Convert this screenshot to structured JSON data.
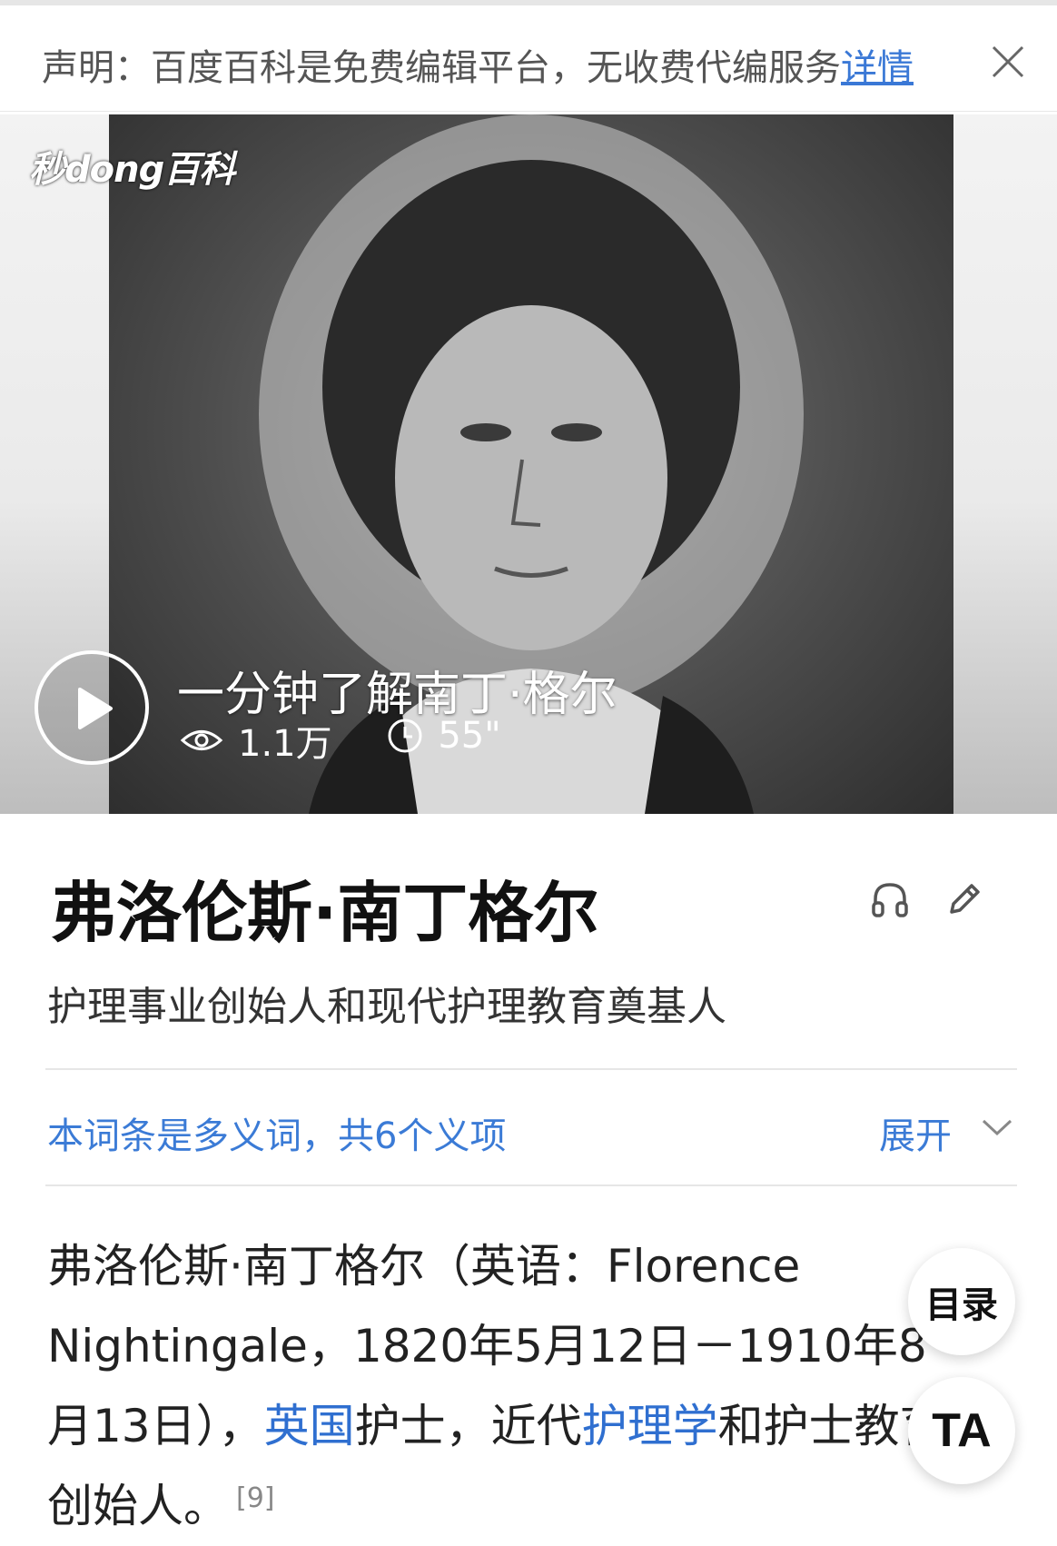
{
  "notice": {
    "text": "声明：百度百科是免费编辑平台，无收费代编服务",
    "link_label": "详情"
  },
  "video": {
    "logo": "秒dong百科",
    "title": "一分钟了解南丁·格尔",
    "views": "1.1万",
    "duration": "55\""
  },
  "entry": {
    "title": "弗洛伦斯·南丁格尔",
    "subtitle": "护理事业创始人和现代护理教育奠基人"
  },
  "polysemy": {
    "text": "本词条是多义词，共6个义项",
    "expand_label": "展开"
  },
  "paragraph": {
    "part1": "弗洛伦斯·南丁格尔（英语：Florence Nightingale，1820年5月12日－1910年8月13日），",
    "link_country": "英国",
    "part2": "护士，近代",
    "link_nursing": "护理学",
    "part3": "和护士教育创始人。",
    "citation": "[9]"
  },
  "floating": {
    "toc_label": "目录",
    "ta_label": "TA"
  },
  "colors": {
    "link": "#3b7bd6",
    "notice_link": "#3a78d6"
  }
}
